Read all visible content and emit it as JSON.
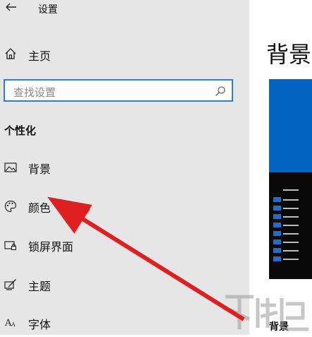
{
  "window": {
    "title": "设置"
  },
  "sidebar": {
    "home_label": "主页",
    "search": {
      "placeholder": "查找设置"
    },
    "section_title": "个性化",
    "items": [
      {
        "label": "背景",
        "icon": "picture-icon"
      },
      {
        "label": "颜色",
        "icon": "palette-icon"
      },
      {
        "label": "锁屏界面",
        "icon": "lock-screen-icon"
      },
      {
        "label": "主题",
        "icon": "theme-brush-icon"
      },
      {
        "label": "字体",
        "icon": "font-icon"
      }
    ]
  },
  "main": {
    "title": "背景",
    "preview_label": "背景"
  },
  "colors": {
    "accent": "#0363c1",
    "sidebar_bg": "#e6e6e6",
    "annotation_arrow": "#e02020"
  }
}
